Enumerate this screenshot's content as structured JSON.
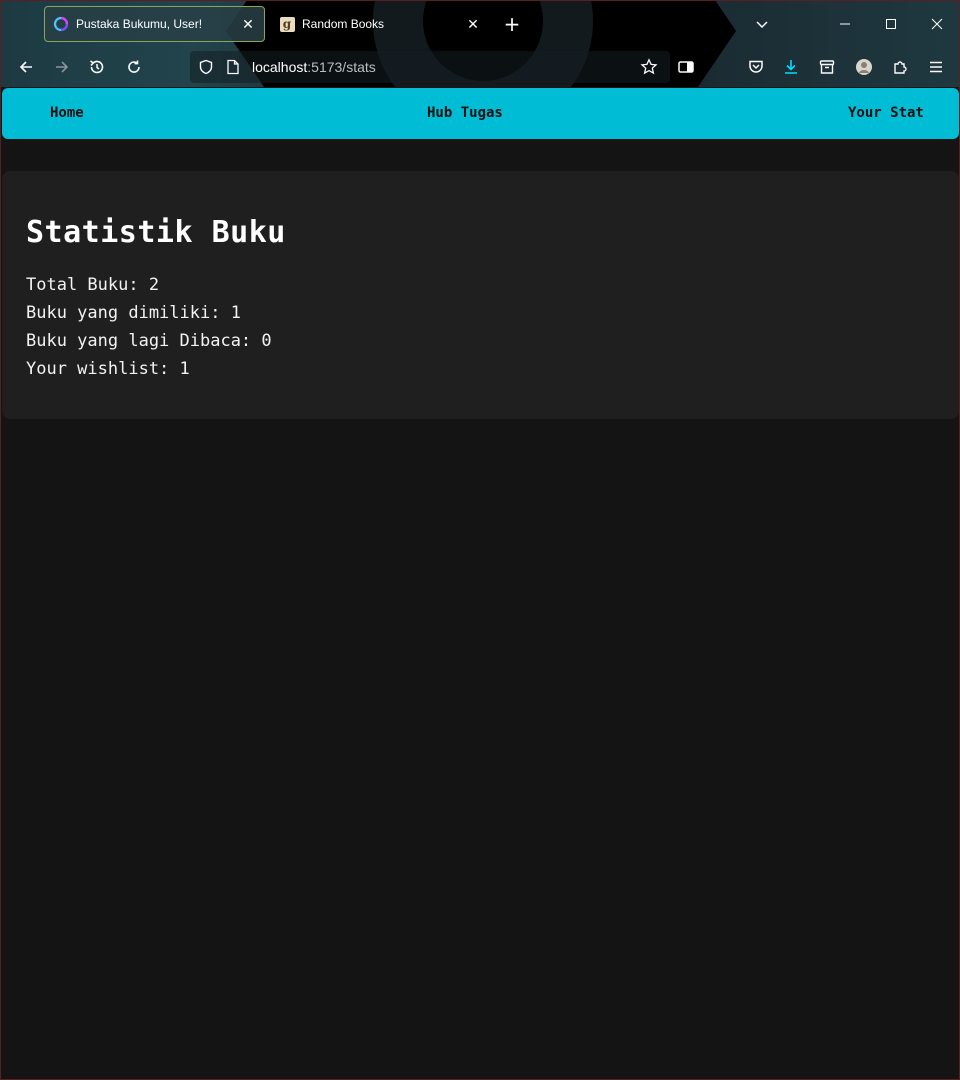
{
  "browser": {
    "tabs": [
      {
        "title": "Pustaka Bukumu, User!",
        "icon": "spinner-icon",
        "active": true
      },
      {
        "title": "Random Books",
        "icon": "goodreads-icon",
        "active": false
      }
    ],
    "url": {
      "host": "localhost",
      "path": ":5173/stats"
    }
  },
  "nav": {
    "home": "Home",
    "hub": "Hub Tugas",
    "stats": "Your Stat"
  },
  "stats": {
    "title": "Statistik Buku",
    "lines": [
      {
        "label": "Total Buku:",
        "value": "2"
      },
      {
        "label": "Buku yang dimiliki:",
        "value": "1"
      },
      {
        "label": "Buku yang lagi Dibaca:",
        "value": "0"
      },
      {
        "label": "Your wishlist:",
        "value": "1"
      }
    ]
  },
  "colors": {
    "accent": "#00bcd4",
    "page_bg": "#141414",
    "card_bg": "#1f1f1f"
  }
}
